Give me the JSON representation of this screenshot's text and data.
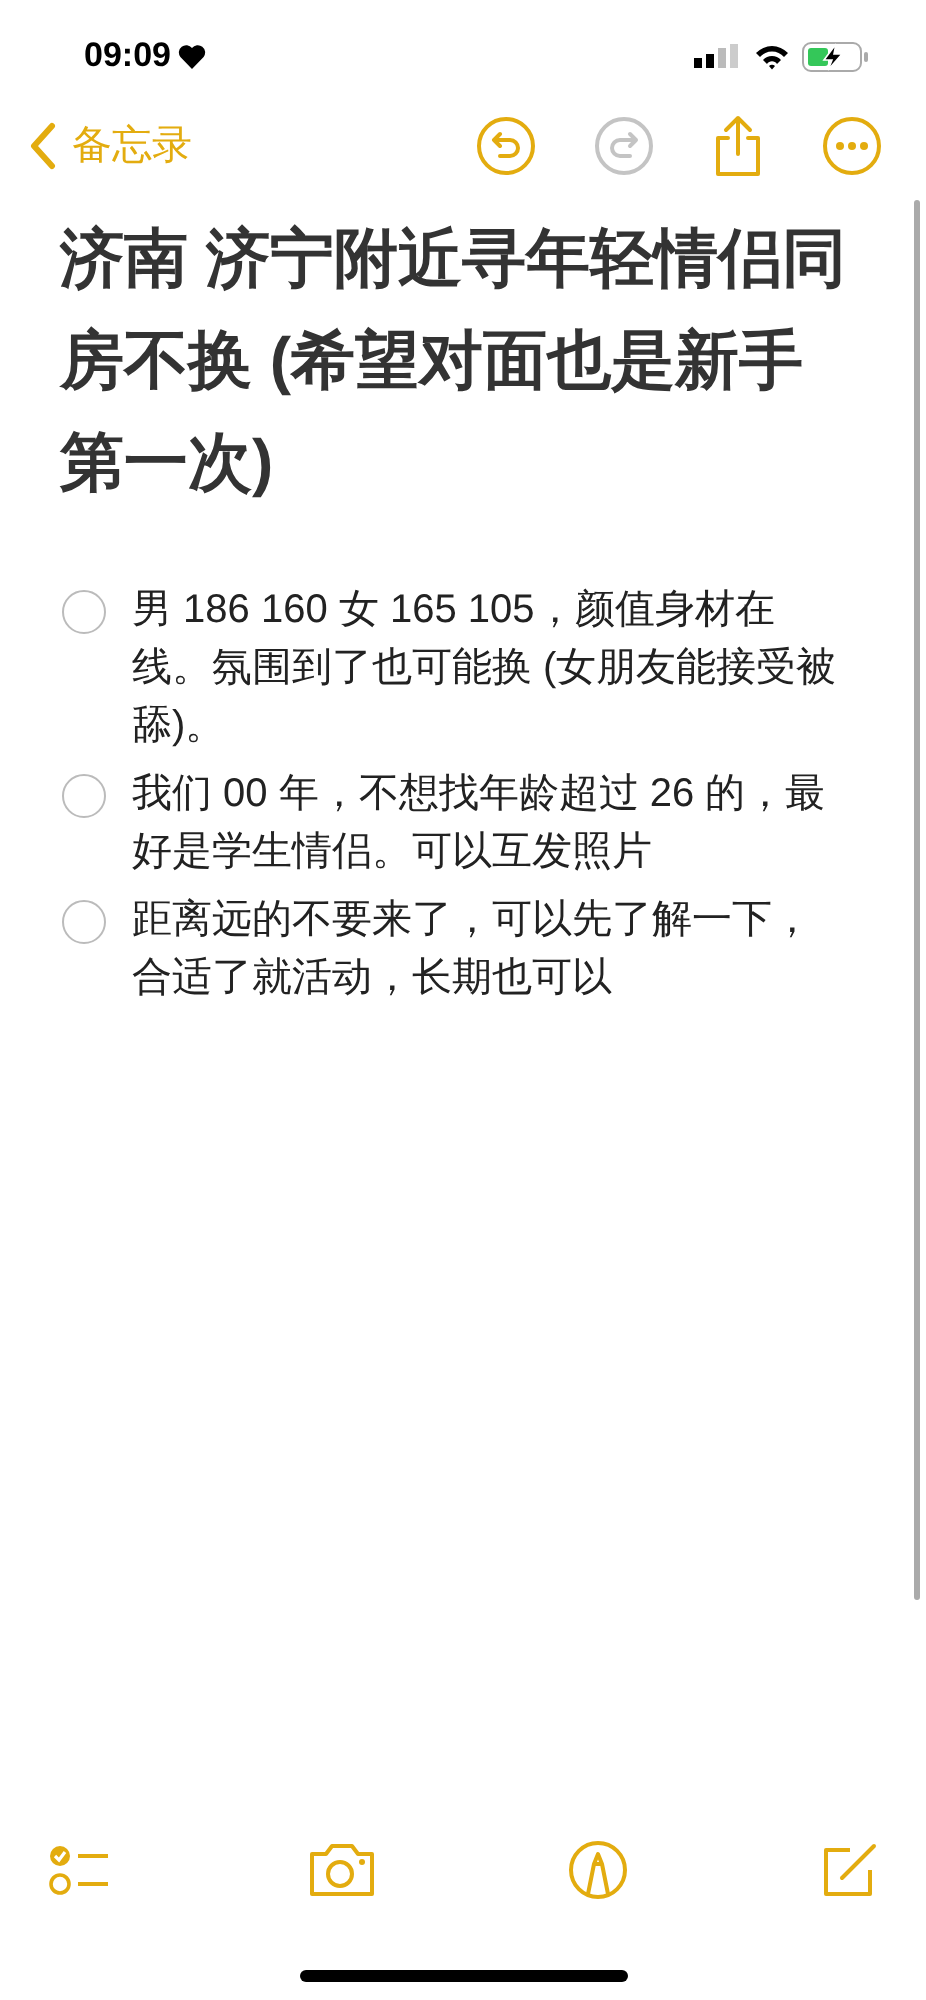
{
  "status_bar": {
    "time": "09:09"
  },
  "nav": {
    "back_label": "备忘录",
    "actions": [
      {
        "kind": "undo",
        "disabled": false
      },
      {
        "kind": "redo",
        "disabled": true
      },
      {
        "kind": "share",
        "disabled": false
      },
      {
        "kind": "more",
        "disabled": false
      }
    ]
  },
  "note": {
    "title": "济南 济宁附近寻年轻情侣同房不换 (希望对面也是新手第一次)",
    "checklist": [
      {
        "text": "男 186 160 女 165 105，颜值身材在线。氛围到了也可能换 (女朋友能接受被舔)。",
        "checked": false
      },
      {
        "text": "我们 00 年，不想找年龄超过 26 的，最好是学生情侣。可以互发照片",
        "checked": false
      },
      {
        "text": "距离远的不要来了，可以先了解一下，合适了就活动，长期也可以",
        "checked": false
      }
    ]
  },
  "toolbar": [
    {
      "kind": "checklist"
    },
    {
      "kind": "camera"
    },
    {
      "kind": "markup"
    },
    {
      "kind": "compose"
    }
  ]
}
